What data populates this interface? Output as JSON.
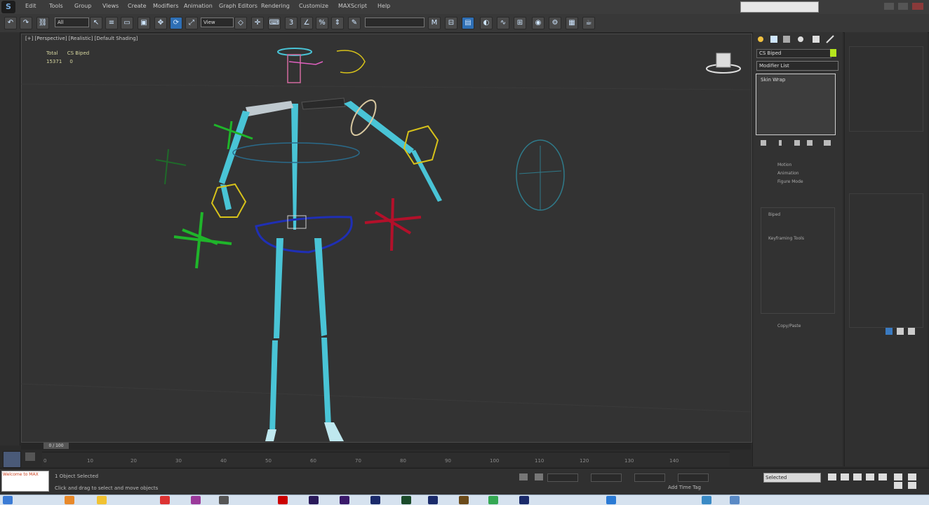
{
  "app": {
    "logo_text": "S"
  },
  "menu": [
    "Edit",
    "Tools",
    "Group",
    "Views",
    "Create",
    "Modifiers",
    "Animation",
    "Graph Editors",
    "Rendering",
    "Customize",
    "MAXScript",
    "Help"
  ],
  "toolbar": {
    "selection_filter": "All",
    "reference_coord": "View",
    "named_selection": ""
  },
  "viewport": {
    "label": "[+] [Perspective] [Realistic] [Default Shading]",
    "stats": {
      "total_label": "Total",
      "total_value": "CS Biped",
      "row2_a": "15371",
      "row2_b": "0"
    }
  },
  "command_panel": {
    "object_name": "CS Biped",
    "modifier_list_label": "Modifier List",
    "stack_item": "Skin Wrap",
    "rollouts": [
      "Motion",
      "Animation",
      "Figure Mode",
      "Biped",
      "Keyframing Tools",
      "Copy/Paste"
    ]
  },
  "timeline": {
    "frame_label": "0 / 100",
    "ticks": [
      "0",
      "10",
      "20",
      "30",
      "40",
      "50",
      "60",
      "70",
      "80",
      "90",
      "100",
      "110",
      "120",
      "130",
      "140"
    ]
  },
  "status": {
    "maxscript_line1": "Welcome to MAX",
    "maxscript_line2": "",
    "message": "1 Object Selected",
    "prompt": "Click and drag to select and move objects",
    "autokey_mode": "Selected",
    "add_time_tag": "Add Time Tag"
  },
  "colors": {
    "bone_cyan": "#49c4d6",
    "helper_green": "#1fb52a",
    "helper_red": "#b3102a",
    "hand_yellow": "#d7c21a",
    "pelvis_blue": "#1f2fb5",
    "accent_lime": "#b5e61d"
  }
}
